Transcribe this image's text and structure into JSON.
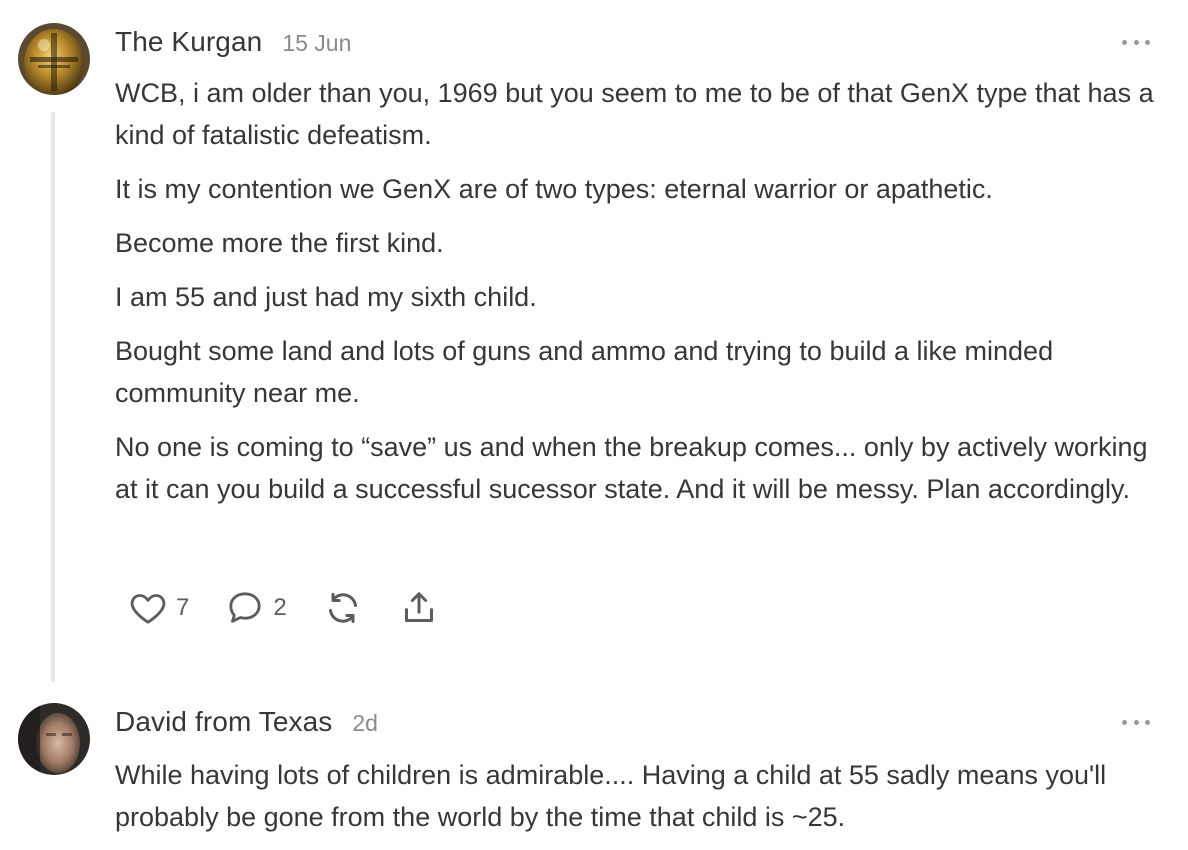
{
  "comments": [
    {
      "author": "The Kurgan",
      "date": "15 Jun",
      "paragraphs": [
        "WCB, i am older than you, 1969 but you seem to me to be of that GenX type that has a kind of fatalistic defeatism.",
        "It is my contention we GenX are of two types: eternal warrior or apathetic.",
        "Become more the first kind.",
        "I am 55 and just had my sixth child.",
        "Bought some land and lots of guns and ammo and trying to build a like minded community near me.",
        "No one is coming to “save” us and when the breakup comes... only by actively working at it can you build a successful sucessor state. And it will be messy. Plan accordingly."
      ],
      "likes": "7",
      "replies": "2",
      "icons": [
        "heart-icon",
        "comment-icon",
        "restack-icon",
        "share-icon"
      ]
    },
    {
      "author": "David from Texas",
      "date": "2d",
      "paragraphs": [
        "While having lots of children is admirable.... Having a child at 55 sadly means you'll probably be gone from the world by the time that child is ~25."
      ]
    }
  ],
  "colors": {
    "text": "#363737",
    "muted": "#8a8a8a",
    "thread_line": "#e6e6e6",
    "icon": "#5c5c5c"
  }
}
